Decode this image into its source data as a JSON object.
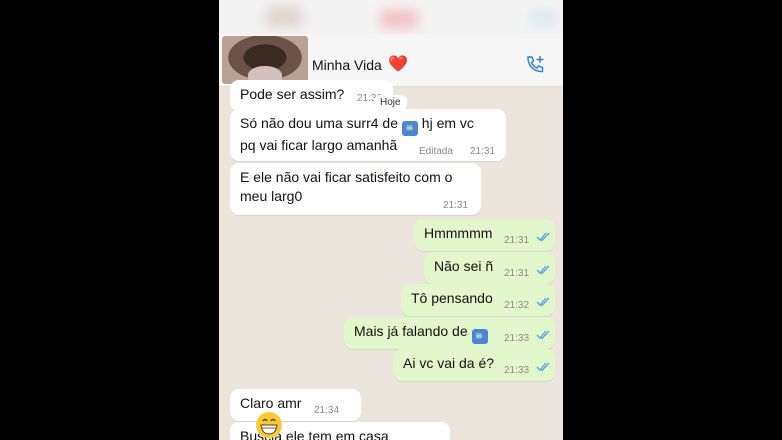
{
  "contact": {
    "name": "Minha Vida",
    "heart": "❤️"
  },
  "date_pill": "Hoje",
  "emoji_cool": "🆒",
  "messages": [
    {
      "dir": "in",
      "text": "Pode ser assim?",
      "time": "21:30"
    },
    {
      "dir": "in",
      "line1": "Só não dou uma surr4 de",
      "line1b": "hj em vc",
      "line2": "pq vai ficar largo amanhã",
      "edited": "Editada",
      "time": "21:31"
    },
    {
      "dir": "in",
      "line1": "E ele não vai ficar satisfeito com o",
      "line2": "meu larg0",
      "time": "21:31"
    },
    {
      "dir": "out",
      "text": "Hmmmmm",
      "time": "21:31"
    },
    {
      "dir": "out",
      "text": "Não sei ñ",
      "time": "21:31"
    },
    {
      "dir": "out",
      "text": "Tô pensando",
      "time": "21:32"
    },
    {
      "dir": "out",
      "text": "Mais já falando de",
      "time": "21:33"
    },
    {
      "dir": "out",
      "text": "Ai vc vai da é?",
      "time": "21:33"
    },
    {
      "dir": "in",
      "text": "Claro amr",
      "time": "21:34"
    },
    {
      "dir": "in",
      "text": "Buscia ele tem em casa",
      "time": ""
    }
  ],
  "colors": {
    "incoming": "#ffffff",
    "outgoing": "#e2f7cb",
    "tick": "#4fa3e0"
  },
  "icons": {
    "add_call": "phone-plus-icon",
    "read_ticks": "double-check-icon"
  }
}
